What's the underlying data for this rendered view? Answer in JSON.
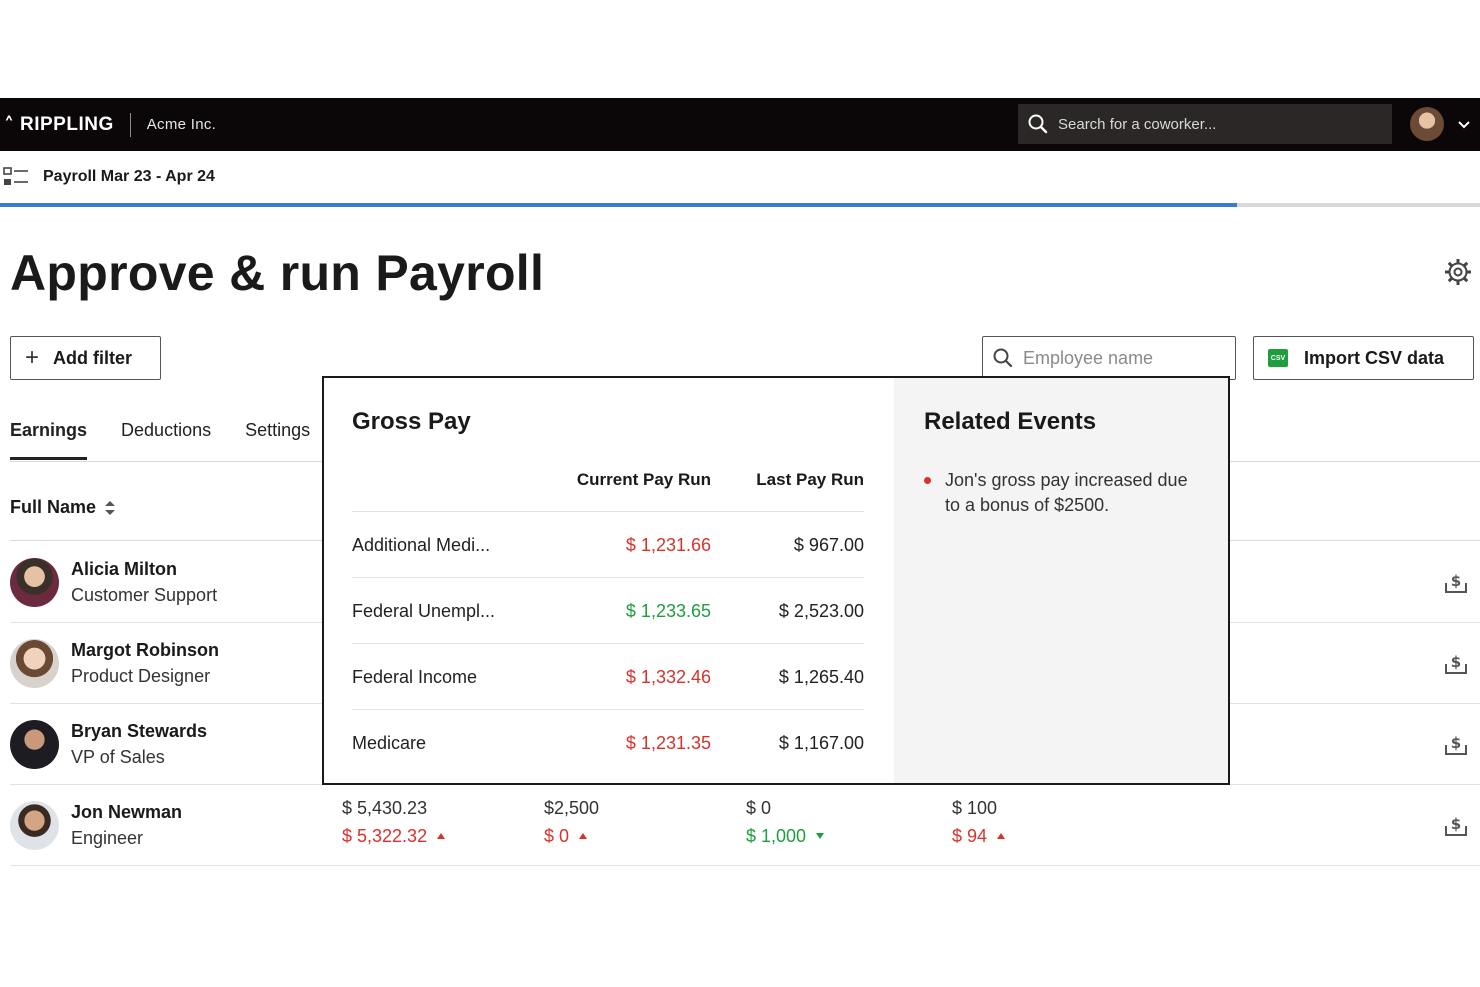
{
  "topbar": {
    "brand": "RIPPLING",
    "company": "Acme Inc.",
    "search_placeholder": "Search for a coworker..."
  },
  "breadcrumb": {
    "label": "Payroll Mar 23 - Apr 24"
  },
  "progress": {
    "fraction": 0.836
  },
  "page": {
    "title": "Approve & run Payroll",
    "add_filter": "Add filter",
    "employee_search_placeholder": "Employee name",
    "import_csv": "Import CSV data",
    "csv_badge": "CSV"
  },
  "tabs": [
    {
      "label": "Earnings",
      "active": true
    },
    {
      "label": "Deductions",
      "active": false
    },
    {
      "label": "Settings",
      "active": false
    }
  ],
  "table": {
    "name_header": "Full Name",
    "rows": [
      {
        "name": "Alicia Milton",
        "role": "Customer Support"
      },
      {
        "name": "Margot Robinson",
        "role": "Product Designer"
      },
      {
        "name": "Bryan Stewards",
        "role": "VP of Sales"
      },
      {
        "name": "Jon Newman",
        "role": "Engineer",
        "values": [
          {
            "top": "$ 5,430.23",
            "bottom": "$ 5,322.32",
            "trend": "up",
            "color": "#d8322c"
          },
          {
            "top": "$2,500",
            "bottom": "$ 0",
            "trend": "up",
            "color": "#d8322c"
          },
          {
            "top": "$ 0",
            "bottom": "$ 1,000",
            "trend": "down",
            "color": "#1e9e3c"
          },
          {
            "top": "$ 100",
            "bottom": "$ 94",
            "trend": "up",
            "color": "#d8322c"
          }
        ]
      }
    ]
  },
  "popover": {
    "title": "Gross Pay",
    "col_current": "Current Pay Run",
    "col_last": "Last Pay Run",
    "rows": [
      {
        "label": "Additional Medi...",
        "current": "$ 1,231.66",
        "current_color": "#d8322c",
        "last": "$ 967.00"
      },
      {
        "label": "Federal Unempl...",
        "current": "$ 1,233.65",
        "current_color": "#1e9e3c",
        "last": "$ 2,523.00"
      },
      {
        "label": "Federal Income",
        "current": "$ 1,332.46",
        "current_color": "#d8322c",
        "last": "$ 1,265.40"
      },
      {
        "label": "Medicare",
        "current": "$ 1,231.35",
        "current_color": "#d8322c",
        "last": "$ 1,167.00"
      }
    ],
    "events_title": "Related Events",
    "events": [
      "Jon's gross pay increased due to a bonus of $2500."
    ]
  },
  "colors": {
    "accent": "#3a79d8",
    "nav_bg": "#0b0708",
    "negative": "#d8322c",
    "positive": "#1e9e3c"
  },
  "icons": [
    "rippling-logo-icon",
    "search-icon",
    "chevron-down-icon",
    "menu-list-icon",
    "gear-icon",
    "plus-icon",
    "csv-file-icon",
    "sort-icon",
    "download-pay-icon"
  ]
}
